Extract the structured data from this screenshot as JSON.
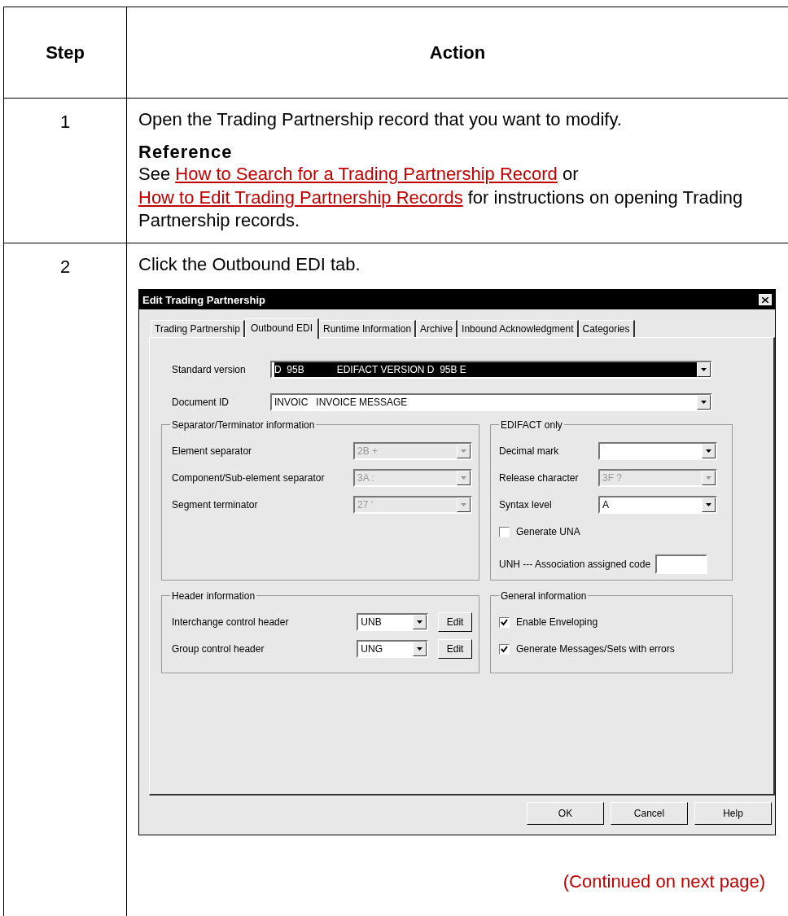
{
  "table": {
    "columns": [
      "Step",
      "Action"
    ],
    "rows": [
      {
        "step": "1",
        "blocks": [
          {
            "kind": "paragraph",
            "segments": [
              {
                "kind": "text",
                "text": "Open the Trading Partnership record that you want to modify."
              }
            ]
          },
          {
            "kind": "heading",
            "text": "Reference"
          },
          {
            "kind": "paragraph",
            "segments": [
              {
                "kind": "text",
                "text": "See "
              },
              {
                "kind": "link",
                "text": "How to Search for a Trading Partnership Record"
              },
              {
                "kind": "text",
                "text": " or "
              },
              {
                "kind": "link",
                "text": "How to Edit Trading Partnership Records"
              },
              {
                "kind": "text",
                "text": " for instructions on opening Trading Partnership records."
              }
            ]
          }
        ]
      },
      {
        "step": "2",
        "blocks": [
          {
            "kind": "paragraph",
            "segments": [
              {
                "kind": "text",
                "text": "Click the Outbound EDI tab."
              }
            ]
          },
          {
            "kind": "dialog"
          },
          {
            "kind": "continued",
            "text": "(Continued on next page)"
          }
        ]
      }
    ]
  },
  "dialog": {
    "title": "Edit Trading Partnership",
    "tabs": [
      {
        "label": "Trading Partnership",
        "selected": false
      },
      {
        "label": "Outbound EDI",
        "selected": true
      },
      {
        "label": "Runtime Information",
        "selected": false
      },
      {
        "label": "Archive",
        "selected": false
      },
      {
        "label": "Inbound Acknowledgment",
        "selected": false
      },
      {
        "label": "Categories",
        "selected": false
      }
    ],
    "fields": [
      {
        "label": "Standard version",
        "value": "D  95B            EDIFACT VERSION D  95B E",
        "highlighted": true
      },
      {
        "label": "Document ID",
        "value": "INVOIC   INVOICE MESSAGE",
        "highlighted": false
      }
    ],
    "groups": [
      {
        "title": "Separator/Terminator information",
        "rows": [
          {
            "kind": "combo",
            "label": "Element separator",
            "value": "2B +",
            "disabled": true
          },
          {
            "kind": "combo",
            "label": "Component/Sub-element separator",
            "value": "3A :",
            "disabled": true
          },
          {
            "kind": "combo",
            "label": "Segment terminator",
            "value": "27 '",
            "disabled": true
          }
        ]
      },
      {
        "title": "EDIFACT only",
        "rows": [
          {
            "kind": "combo",
            "label": "Decimal mark",
            "disabled": false
          },
          {
            "kind": "combo",
            "label": "Release character",
            "value": "3F ?",
            "disabled": true
          },
          {
            "kind": "combo",
            "label": "Syntax level",
            "value": "A",
            "disabled": false
          },
          {
            "kind": "checkbox",
            "label": "Generate UNA",
            "checked": false
          },
          {
            "kind": "textbox",
            "label": "UNH --- Association assigned code"
          }
        ]
      },
      {
        "title": "Header information",
        "rows": [
          {
            "kind": "combo_edit",
            "label": "Interchange control header",
            "value": "UNB",
            "button": "Edit"
          },
          {
            "kind": "combo_edit",
            "label": "Group control header",
            "value": "UNG",
            "button": "Edit"
          }
        ]
      },
      {
        "title": "General information",
        "rows": [
          {
            "kind": "checkbox",
            "label": "Enable Enveloping",
            "checked": true
          },
          {
            "kind": "checkbox",
            "label": "Generate Messages/Sets with errors",
            "checked": true
          }
        ]
      }
    ],
    "buttons": [
      "OK",
      "Cancel",
      "Help"
    ]
  }
}
